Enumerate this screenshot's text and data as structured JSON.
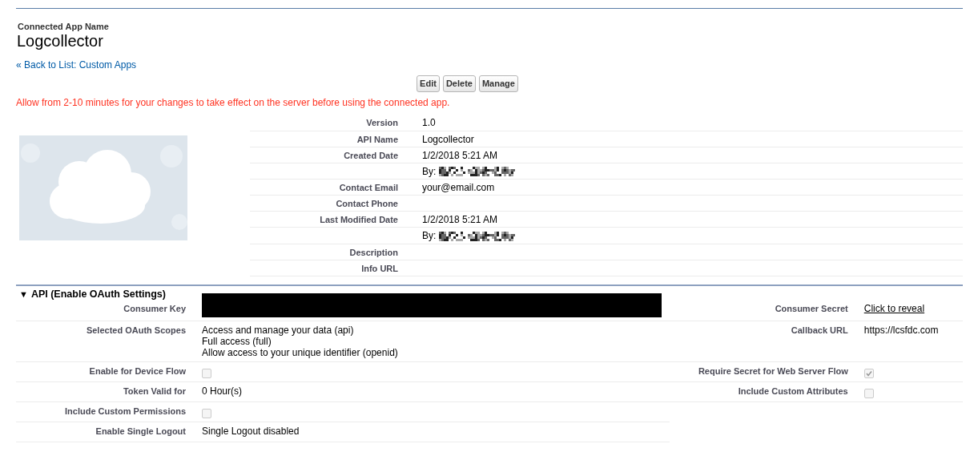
{
  "header": {
    "label": "Connected App Name",
    "title": "Logcollector"
  },
  "back_link": "« Back to List: Custom Apps",
  "buttons": [
    "Edit",
    "Delete",
    "Manage"
  ],
  "notice": "Allow from 2-10 minutes for your changes to take effect on the server before using the connected app.",
  "details": [
    {
      "label": "Version",
      "kind": "text",
      "value": "1.0"
    },
    {
      "label": "API Name",
      "kind": "text",
      "value": "Logcollector"
    },
    {
      "label": "Created Date",
      "kind": "text",
      "value": "1/2/2018 5:21 AM"
    },
    {
      "kind": "redacted",
      "value": "By:"
    },
    {
      "label": "Contact Email",
      "kind": "text",
      "value": "your@email.com"
    },
    {
      "label": "Contact Phone",
      "kind": "text"
    },
    {
      "label": "Last Modified Date",
      "kind": "text",
      "value": "1/2/2018 5:21 AM"
    },
    {
      "kind": "redacted",
      "value": "By:"
    },
    {
      "label": "Description",
      "kind": "text"
    },
    {
      "label": "Info URL",
      "kind": "text"
    }
  ],
  "api_section": {
    "toggle": "▼",
    "title": "API (Enable OAuth Settings)",
    "rows": [
      {
        "left": {
          "label": "Consumer Key",
          "kind": "blacked_out"
        },
        "right": {
          "label": "Consumer Secret",
          "kind": "link",
          "value": "Click to reveal"
        }
      },
      {
        "left": {
          "label": "Selected OAuth Scopes",
          "kind": "lines",
          "lines": [
            "Access and manage your data (api)",
            "Full access (full)",
            "Allow access to your unique identifier (openid)"
          ]
        },
        "right": {
          "label": "Callback URL",
          "kind": "text",
          "value": "https://lcsfdc.com"
        }
      },
      {
        "left": {
          "label": "Enable for Device Flow",
          "kind": "checkbox",
          "checked": false
        },
        "right": {
          "label": "Require Secret for Web Server Flow",
          "kind": "checkbox",
          "checked": true
        }
      },
      {
        "left": {
          "label": "Token Valid for",
          "kind": "text",
          "value": "0 Hour(s)"
        },
        "right": {
          "label": "Include Custom Attributes",
          "kind": "checkbox",
          "checked": false
        }
      },
      {
        "left": {
          "label": "Include Custom Permissions",
          "kind": "checkbox",
          "checked": false
        }
      },
      {
        "left": {
          "label": "Enable Single Logout",
          "kind": "text",
          "value": "Single Logout disabled"
        }
      }
    ]
  }
}
